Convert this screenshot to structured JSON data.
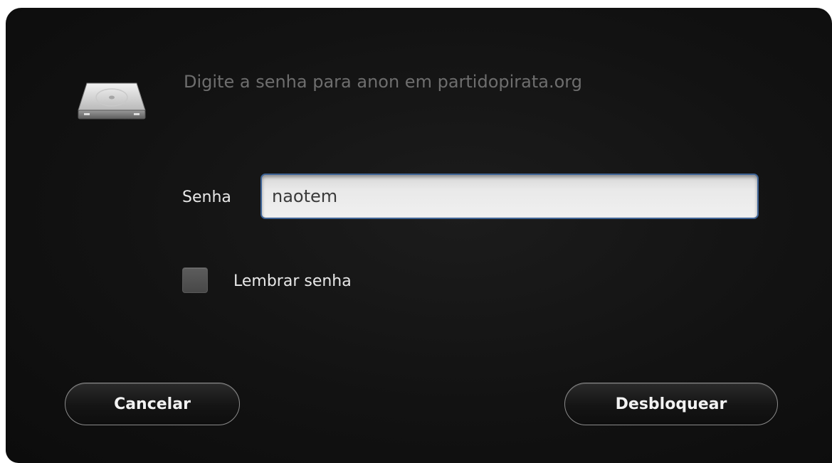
{
  "dialog": {
    "title": "Digite a senha para anon em partidopirata.org",
    "icon": "drive-icon",
    "password_label": "Senha",
    "password_value": "naotem",
    "remember_label": "Lembrar senha",
    "remember_checked": false,
    "cancel_label": "Cancelar",
    "unlock_label": "Desbloquear"
  },
  "colors": {
    "background": "#121212",
    "title_text": "#6e6e6e",
    "label_text": "#e8e8e8",
    "input_focus_border": "#3f6496"
  }
}
